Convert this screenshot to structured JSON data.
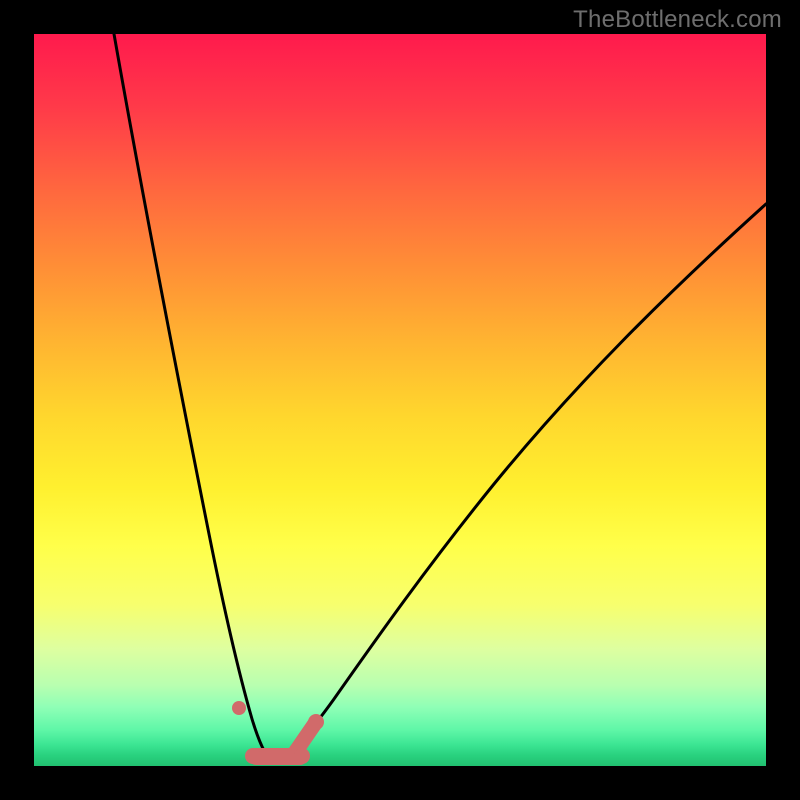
{
  "watermark": "TheBottleneck.com",
  "colors": {
    "background": "#000000",
    "gradient_top": "#ff1a4d",
    "gradient_bottom": "#21c070",
    "curve": "#000000",
    "markers": "#d16a6a",
    "watermark_text": "#6e6e6e"
  },
  "chart_data": {
    "type": "line",
    "title": "",
    "xlabel": "",
    "ylabel": "",
    "xlim": [
      0,
      100
    ],
    "ylim": [
      0,
      100
    ],
    "notes": "Bottleneck-style V curve. No axis tick labels are visible; x and y are normalized 0–100. Curve minimum (optimal balance) is near x≈32. Salmon markers sit along the valley floor indicating the recommended range.",
    "series": [
      {
        "name": "left-branch",
        "x": [
          11,
          14,
          17,
          20,
          23,
          25,
          27,
          29,
          30,
          31,
          32
        ],
        "y": [
          100,
          81,
          62,
          45,
          30,
          20,
          12,
          6,
          3,
          1,
          0
        ]
      },
      {
        "name": "right-branch",
        "x": [
          32,
          34,
          36,
          39,
          43,
          48,
          54,
          62,
          72,
          84,
          100
        ],
        "y": [
          0,
          1,
          3,
          6,
          11,
          18,
          27,
          38,
          50,
          62,
          77
        ]
      }
    ],
    "markers": [
      {
        "name": "dot-left",
        "x": 27.5,
        "y": 7.5
      },
      {
        "name": "valley-bar-start-x",
        "x": 29
      },
      {
        "name": "valley-bar-end-x",
        "x": 37
      },
      {
        "name": "segment-right",
        "x_start": 35,
        "x_end": 37.5,
        "y_start": 2,
        "y_end": 6
      }
    ]
  }
}
